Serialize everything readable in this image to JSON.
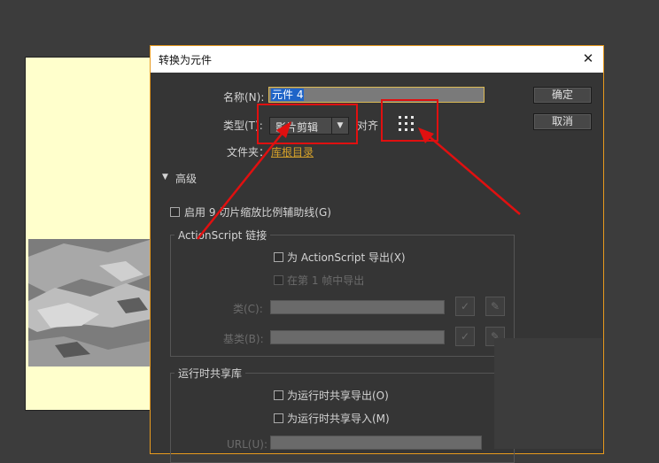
{
  "dialog": {
    "title": "转换为元件",
    "close_glyph": "✕",
    "name_label": "名称(N):",
    "name_value": "元件 4",
    "type_label": "类型(T):",
    "type_value": "影片剪辑",
    "align_label": "对齐",
    "folder_label": "文件夹：",
    "folder_value": "库根目录",
    "ok_label": "确定",
    "cancel_label": "取消",
    "advanced_label": "高级",
    "enable_9slice_label": "启用 9 切片缩放比例辅助线(G)",
    "as_group_label": "ActionScript 链接",
    "export_as_label": "为 ActionScript 导出(X)",
    "export_frame1_label": "在第 1 帧中导出",
    "class_label": "类(C):",
    "base_class_label": "基类(B):",
    "shared_group_label": "运行时共享库",
    "export_share_label": "为运行时共享导出(O)",
    "import_share_label": "为运行时共享导入(M)",
    "url_label": "URL(U):",
    "check_glyph": "✓",
    "pencil_glyph": "✎",
    "dropdown_glyph": "▼",
    "triangle_glyph": "▼"
  },
  "colors": {
    "annotation": "#e01010",
    "stage_bg": "#ffffcc",
    "link": "#d6a22a"
  }
}
